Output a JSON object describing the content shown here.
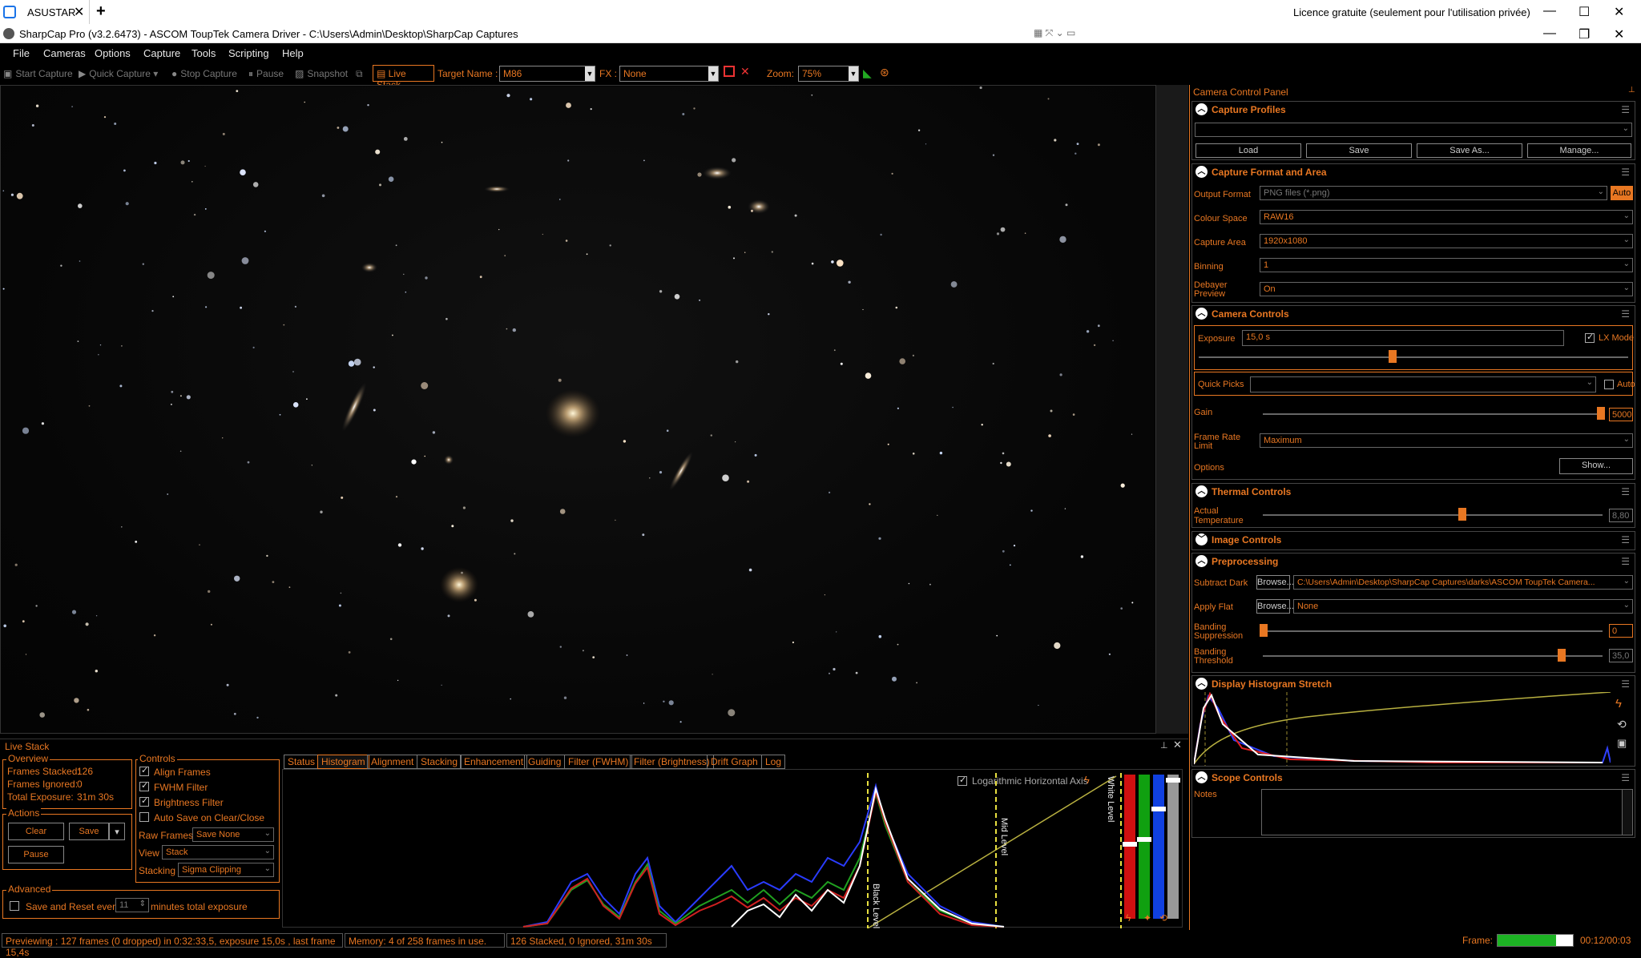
{
  "browser": {
    "tab_title": "ASUSTAR",
    "tab_close": "✕",
    "new_tab": "+",
    "licence": "Licence gratuite (seulement pour l'utilisation privée)",
    "win_min": "—",
    "win_max": "☐",
    "win_close": "✕"
  },
  "app": {
    "title": "SharpCap Pro (v3.2.6473) - ASCOM ToupTek Camera Driver - C:\\Users\\Admin\\Desktop\\SharpCap Captures",
    "win_min": "—",
    "win_restore": "❐",
    "win_close": "✕"
  },
  "menu": [
    "File",
    "Cameras",
    "Options",
    "Capture",
    "Tools",
    "Scripting",
    "Help"
  ],
  "toolbar": {
    "start_capture": "Start Capture",
    "quick_capture": "Quick Capture",
    "stop_capture": "Stop Capture",
    "pause": "Pause",
    "snapshot": "Snapshot",
    "live_stack": "Live Stack",
    "target_label": "Target Name :",
    "target_value": "M86",
    "fx_label": "FX :",
    "fx_value": "None",
    "zoom_label": "Zoom:",
    "zoom_value": "75%"
  },
  "panel": {
    "title": "Camera Control Panel",
    "pin": "📌",
    "capture_profiles": {
      "header": "Capture Profiles",
      "profile_value": "",
      "load": "Load",
      "save": "Save",
      "save_as": "Save As...",
      "manage": "Manage..."
    },
    "capture_format": {
      "header": "Capture Format and Area",
      "output_format_label": "Output Format",
      "output_format_value": "PNG files (*.png)",
      "auto": "Auto",
      "colour_space_label": "Colour Space",
      "colour_space_value": "RAW16",
      "capture_area_label": "Capture Area",
      "capture_area_value": "1920x1080",
      "binning_label": "Binning",
      "binning_value": "1",
      "debayer_label_1": "Debayer",
      "debayer_label_2": "Preview",
      "debayer_value": "On"
    },
    "camera_controls": {
      "header": "Camera Controls",
      "exposure_label": "Exposure",
      "exposure_value": "15,0 s",
      "lx_mode": "LX Mode",
      "quick_picks_label": "Quick Picks",
      "quick_picks_auto": "Auto",
      "gain_label": "Gain",
      "gain_value": "5000",
      "frame_rate_label_1": "Frame Rate",
      "frame_rate_label_2": "Limit",
      "frame_rate_value": "Maximum",
      "options_label": "Options",
      "show_button": "Show..."
    },
    "thermal_controls": {
      "header": "Thermal Controls",
      "temp_label_1": "Actual",
      "temp_label_2": "Temperature",
      "temp_value": "8,80"
    },
    "image_controls": {
      "header": "Image Controls"
    },
    "preprocessing": {
      "header": "Preprocessing",
      "subtract_dark_label": "Subtract Dark",
      "browse": "Browse...",
      "dark_path": "C:\\Users\\Admin\\Desktop\\SharpCap Captures\\darks\\ASCOM ToupTek Camera...",
      "apply_flat_label": "Apply Flat",
      "flat_value": "None",
      "banding_supp_label_1": "Banding",
      "banding_supp_label_2": "Suppression",
      "banding_supp_value": "0",
      "banding_thr_label_1": "Banding",
      "banding_thr_label_2": "Threshold",
      "banding_thr_value": "35,0"
    },
    "histogram_stretch": {
      "header": "Display Histogram Stretch"
    },
    "scope_controls": {
      "header": "Scope Controls",
      "notes_label": "Notes"
    }
  },
  "livestack": {
    "title": "Live Stack",
    "overview": {
      "header": "Overview",
      "frames_stacked_label": "Frames Stacked:",
      "frames_stacked": "126",
      "frames_ignored_label": "Frames Ignored:",
      "frames_ignored": "0",
      "total_exposure_label": "Total Exposure:",
      "total_exposure": "31m 30s"
    },
    "actions": {
      "header": "Actions",
      "clear": "Clear",
      "save": "Save",
      "pause": "Pause"
    },
    "controls": {
      "header": "Controls",
      "align_frames": "Align Frames",
      "fwhm_filter": "FWHM Filter",
      "brightness_filter": "Brightness Filter",
      "auto_save": "Auto Save on Clear/Close",
      "raw_frames_label": "Raw Frames",
      "raw_frames_value": "Save None",
      "view_label": "View",
      "view_value": "Stack",
      "stacking_label": "Stacking",
      "stacking_value": "Sigma Clipping"
    },
    "advanced": {
      "header": "Advanced",
      "save_reset": "Save and Reset every",
      "minutes": "11",
      "minutes_suffix": "minutes total exposure"
    },
    "tabs": [
      "Status",
      "Histogram",
      "Alignment",
      "Stacking",
      "Enhancement",
      "Guiding",
      "Filter (FWHM)",
      "Filter (Brightness)",
      "Drift Graph",
      "Log"
    ],
    "active_tab": "Histogram",
    "histogram": {
      "log_axis": "Logarithmic Horizontal Axis",
      "black_level": "Black Level",
      "mid_level": "Mid Level",
      "white_level": "White Level"
    }
  },
  "status": {
    "previewing": "Previewing : 127 frames (0 dropped) in 0:32:33,5, exposure 15,0s , last frame 15,4s",
    "memory": "Memory: 4 of 258 frames in use.",
    "stacked": "126 Stacked, 0 Ignored, 31m 30s",
    "frame_label": "Frame:",
    "frame_progress": 0.78,
    "frame_time": "00:12/00:03"
  },
  "colors": {
    "accent": "#e87722",
    "bg": "#000000",
    "frame_fill": "#1db324"
  }
}
